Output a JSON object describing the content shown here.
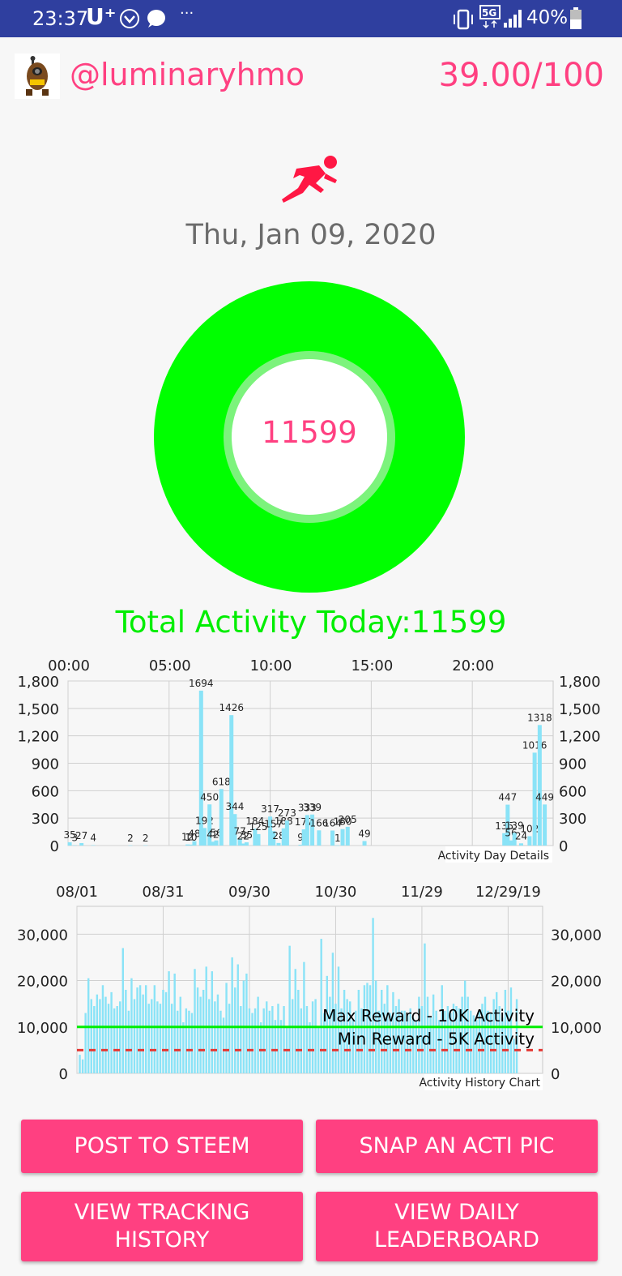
{
  "status_bar": {
    "time": "23:37",
    "carrier": "U⁺",
    "battery": "40%",
    "more": "···",
    "icons": [
      "vibrate-icon",
      "5g-icon",
      "signal-icon",
      "battery-icon",
      "v-icon",
      "chat-bubble-icon"
    ]
  },
  "header": {
    "username": "@luminaryhmo",
    "score": "39.00/100",
    "avatar_icon": "robot-avatar"
  },
  "runner_icon": "running-person-icon",
  "date": "Thu, Jan 09, 2020",
  "ring": {
    "value": "11599",
    "progress": 1.0,
    "color": "#00ff00",
    "inner_color": "#7cf37c"
  },
  "total_activity": "Total Activity Today:11599",
  "colors": {
    "accent": "#ff4081",
    "bar": "#8ae3f7",
    "green": "#00ee00",
    "red_dashed": "#e53935"
  },
  "chart_data": [
    {
      "type": "bar",
      "title": "Activity Day Details",
      "x_unit": "minutes-of-day",
      "x_ticks": [
        {
          "label": "00:00",
          "x": 0
        },
        {
          "label": "05:00",
          "x": 300
        },
        {
          "label": "10:00",
          "x": 600
        },
        {
          "label": "15:00",
          "x": 900
        },
        {
          "label": "20:00",
          "x": 1200
        }
      ],
      "xlim": [
        0,
        1440
      ],
      "ylim": [
        0,
        1800
      ],
      "y_ticks": [
        "0",
        "300",
        "600",
        "900",
        "1,200",
        "1,500",
        "1,800"
      ],
      "y_tick_values": [
        0,
        300,
        600,
        900,
        1200,
        1500,
        1800
      ],
      "grid": true,
      "bars": [
        {
          "x": 5,
          "y": 35,
          "label": "35"
        },
        {
          "x": 20,
          "y": 3,
          "label": "3"
        },
        {
          "x": 40,
          "y": 27,
          "label": "27"
        },
        {
          "x": 75,
          "y": 4,
          "label": "4"
        },
        {
          "x": 185,
          "y": 2,
          "label": "2"
        },
        {
          "x": 230,
          "y": 2,
          "label": "2"
        },
        {
          "x": 355,
          "y": 12,
          "label": "12"
        },
        {
          "x": 365,
          "y": 10,
          "label": "10"
        },
        {
          "x": 375,
          "y": 48,
          "label": "48"
        },
        {
          "x": 395,
          "y": 1694,
          "label": "1694"
        },
        {
          "x": 405,
          "y": 192,
          "label": "192"
        },
        {
          "x": 420,
          "y": 450,
          "label": "450"
        },
        {
          "x": 430,
          "y": 42,
          "label": "42"
        },
        {
          "x": 440,
          "y": 56,
          "label": "56"
        },
        {
          "x": 455,
          "y": 618,
          "label": "618"
        },
        {
          "x": 485,
          "y": 1426,
          "label": "1426"
        },
        {
          "x": 495,
          "y": 344,
          "label": "344"
        },
        {
          "x": 510,
          "y": 77,
          "label": "77"
        },
        {
          "x": 520,
          "y": 22,
          "label": "22"
        },
        {
          "x": 530,
          "y": 35,
          "label": "35"
        },
        {
          "x": 555,
          "y": 184,
          "label": "184"
        },
        {
          "x": 565,
          "y": 125,
          "label": "125"
        },
        {
          "x": 600,
          "y": 317,
          "label": "317"
        },
        {
          "x": 610,
          "y": 157,
          "label": "157"
        },
        {
          "x": 625,
          "y": 28,
          "label": "28"
        },
        {
          "x": 640,
          "y": 188,
          "label": "188"
        },
        {
          "x": 650,
          "y": 273,
          "label": "273"
        },
        {
          "x": 690,
          "y": 9,
          "label": "9"
        },
        {
          "x": 700,
          "y": 177,
          "label": "177"
        },
        {
          "x": 710,
          "y": 333,
          "label": "333"
        },
        {
          "x": 725,
          "y": 339,
          "label": "339"
        },
        {
          "x": 745,
          "y": 166,
          "label": "166"
        },
        {
          "x": 785,
          "y": 164,
          "label": "164"
        },
        {
          "x": 800,
          "y": 1,
          "label": "1"
        },
        {
          "x": 815,
          "y": 180,
          "label": "180"
        },
        {
          "x": 830,
          "y": 205,
          "label": "205"
        },
        {
          "x": 880,
          "y": 49,
          "label": "49"
        },
        {
          "x": 1295,
          "y": 135,
          "label": "135"
        },
        {
          "x": 1305,
          "y": 447,
          "label": "447"
        },
        {
          "x": 1315,
          "y": 56,
          "label": "56"
        },
        {
          "x": 1325,
          "y": 139,
          "label": "139"
        },
        {
          "x": 1345,
          "y": 24,
          "label": "24"
        },
        {
          "x": 1370,
          "y": 102,
          "label": "102"
        },
        {
          "x": 1385,
          "y": 1016,
          "label": "1016"
        },
        {
          "x": 1400,
          "y": 1318,
          "label": "1318"
        },
        {
          "x": 1415,
          "y": 449,
          "label": "449"
        }
      ]
    },
    {
      "type": "bar",
      "title": "Activity History Chart",
      "x_ticks": [
        "08/01",
        "08/31",
        "09/30",
        "10/30",
        "11/29",
        "12/29/19"
      ],
      "x_tick_days": [
        0,
        30,
        60,
        90,
        120,
        150
      ],
      "xlim": [
        0,
        162
      ],
      "ylim": [
        0,
        36000
      ],
      "y_ticks": [
        "0",
        "10,000",
        "20,000",
        "30,000"
      ],
      "y_tick_values": [
        0,
        10000,
        20000,
        30000
      ],
      "grid": true,
      "lines": [
        {
          "name": "Max Reward - 10K Activity",
          "value": 10000,
          "style": "solid",
          "color": "#00ee00"
        },
        {
          "name": "Min Reward - 5K Activity",
          "value": 5000,
          "style": "dashed",
          "color": "#e53935"
        }
      ],
      "values": [
        4000,
        3000,
        13000,
        20500,
        16000,
        14500,
        17000,
        16000,
        19000,
        16500,
        15000,
        17500,
        14000,
        14500,
        15500,
        27000,
        18000,
        13500,
        20500,
        16000,
        18500,
        19000,
        17000,
        19000,
        15000,
        16000,
        19000,
        15500,
        15000,
        18000,
        17500,
        22000,
        15000,
        21500,
        13500,
        16500,
        11000,
        14000,
        13500,
        13000,
        22500,
        18500,
        16500,
        18000,
        23000,
        16000,
        22000,
        15500,
        17000,
        13500,
        12000,
        19500,
        15000,
        25000,
        18500,
        23500,
        14500,
        20000,
        21500,
        14000,
        13000,
        14000,
        16500,
        11000,
        14000,
        15500,
        13500,
        14500,
        11500,
        15000,
        11500,
        14500,
        10000,
        27500,
        16000,
        22500,
        18000,
        14000,
        24000,
        14500,
        11000,
        15500,
        16000,
        10000,
        29000,
        13000,
        21000,
        16500,
        26000,
        15000,
        23000,
        14000,
        18000,
        16000,
        15500,
        11500,
        13500,
        18000,
        14000,
        19000,
        19500,
        19000,
        33500,
        20000,
        13500,
        18000,
        15000,
        19000,
        13000,
        17500,
        14500,
        16000,
        13500,
        13500,
        12500,
        14000,
        12000,
        11500,
        16500,
        14500,
        28000,
        16500,
        12000,
        17000,
        13500,
        11500,
        19000,
        13500,
        14500,
        13000,
        15000,
        14500,
        14000,
        16500,
        20000,
        16500,
        13500,
        12500,
        11500,
        13500,
        15000,
        16500,
        13500,
        13000,
        16000,
        17500,
        14500,
        12000,
        18000,
        13500,
        18500,
        7500,
        16000
      ]
    }
  ],
  "buttons": {
    "post": "POST TO STEEM",
    "snap": "SNAP AN ACTI PIC",
    "history_line1": "VIEW TRACKING",
    "history_line2": "HISTORY",
    "leader_line1": "VIEW DAILY",
    "leader_line2": "LEADERBOARD"
  }
}
